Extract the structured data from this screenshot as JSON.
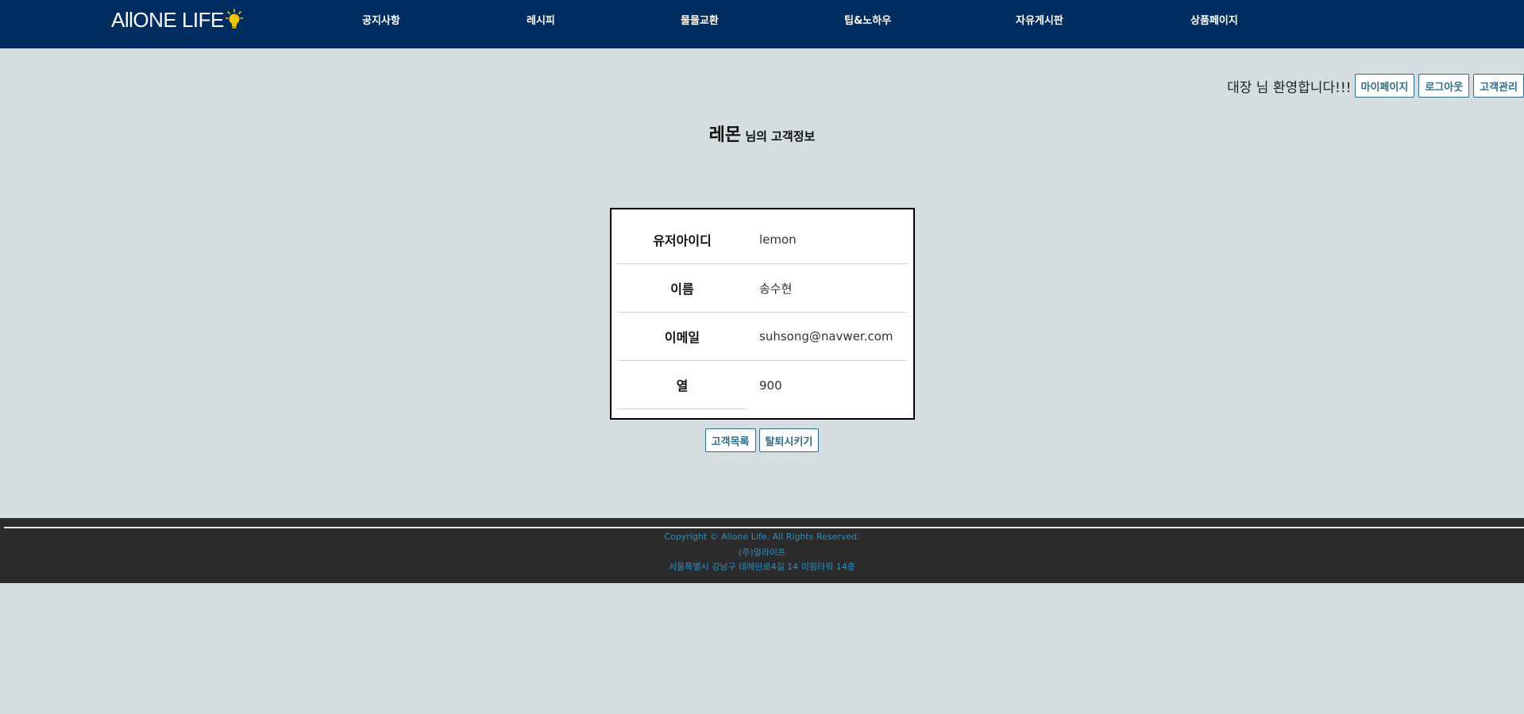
{
  "header": {
    "logo_text": "AllONE LIFE",
    "nav": [
      "공지사항",
      "레시피",
      "물물교환",
      "팁&노하우",
      "자유게시판",
      "상품페이지"
    ]
  },
  "welcome": {
    "text": "대장 님 환영합니다!!!",
    "buttons": [
      "마이페이지",
      "로그아웃",
      "고객관리"
    ]
  },
  "page_title": {
    "nickname": "레몬",
    "suffix": " 님의 고객정보"
  },
  "info": [
    {
      "label": "유저아이디",
      "value": "lemon"
    },
    {
      "label": "이름",
      "value": "송수현"
    },
    {
      "label": "이메일",
      "value": "suhsong@navwer.com"
    },
    {
      "label": "열",
      "value": "900"
    }
  ],
  "actions": {
    "list_label": "고객목록",
    "withdraw_label": "탈퇴시키기"
  },
  "footer": {
    "copyright": "Copyright © Allone Life. All Rights Reserved.",
    "company": "(주)얼라이프",
    "address": "서울특별시 강남구 테헤란로4길 14 미림타워 14층"
  },
  "colors": {
    "nav_bg": "#002c5f",
    "page_bg": "#d4dde0",
    "footer_bg": "#2b2b2b",
    "footer_text": "#2e8fbf",
    "button_text": "#2c6e8a",
    "bulb": "#f5c400"
  }
}
